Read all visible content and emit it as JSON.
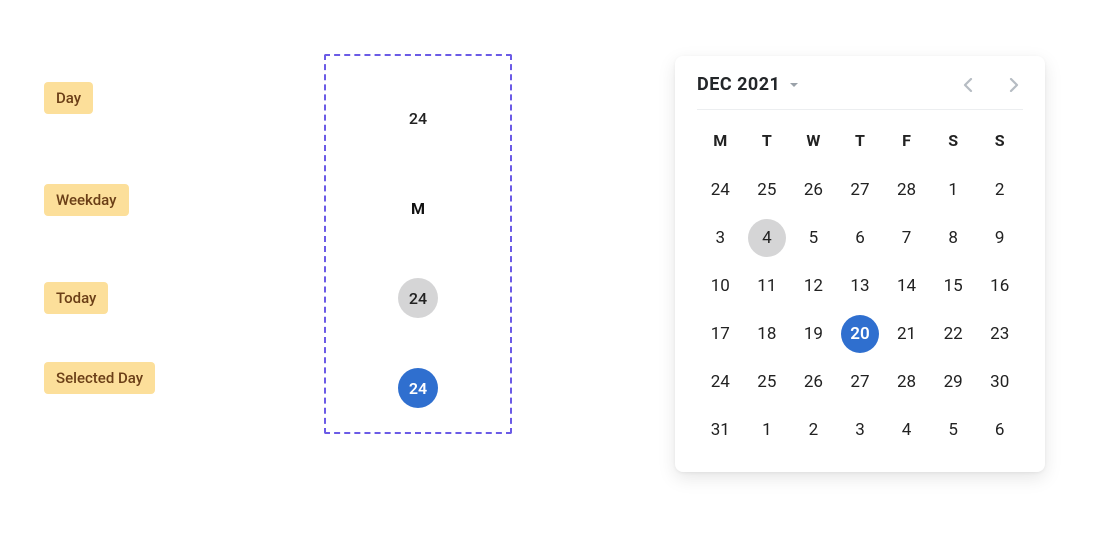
{
  "legend": {
    "day": "Day",
    "weekday": "Weekday",
    "today": "Today",
    "selected": "Selected Day"
  },
  "samples": {
    "plain_day": "24",
    "weekday_label": "M",
    "today_day": "24",
    "selected_day": "24"
  },
  "calendar": {
    "month_label": "DEC 2021",
    "weekday_headers": [
      "M",
      "T",
      "W",
      "T",
      "F",
      "S",
      "S"
    ],
    "today_index": 8,
    "selected_index": 24,
    "cells": [
      "24",
      "25",
      "26",
      "27",
      "28",
      "1",
      "2",
      "3",
      "4",
      "5",
      "6",
      "7",
      "8",
      "9",
      "10",
      "11",
      "12",
      "13",
      "14",
      "15",
      "16",
      "17",
      "18",
      "19",
      "20",
      "21",
      "22",
      "23",
      "24",
      "25",
      "26",
      "27",
      "28",
      "29",
      "30",
      "31",
      "1",
      "2",
      "3",
      "4",
      "5",
      "6"
    ]
  },
  "colors": {
    "chip_bg": "#fcdf9a",
    "chip_text": "#6b3f17",
    "dashed_border": "#6b5be6",
    "today_bg": "#d5d5d6",
    "selected_bg": "#2f6fcf"
  }
}
